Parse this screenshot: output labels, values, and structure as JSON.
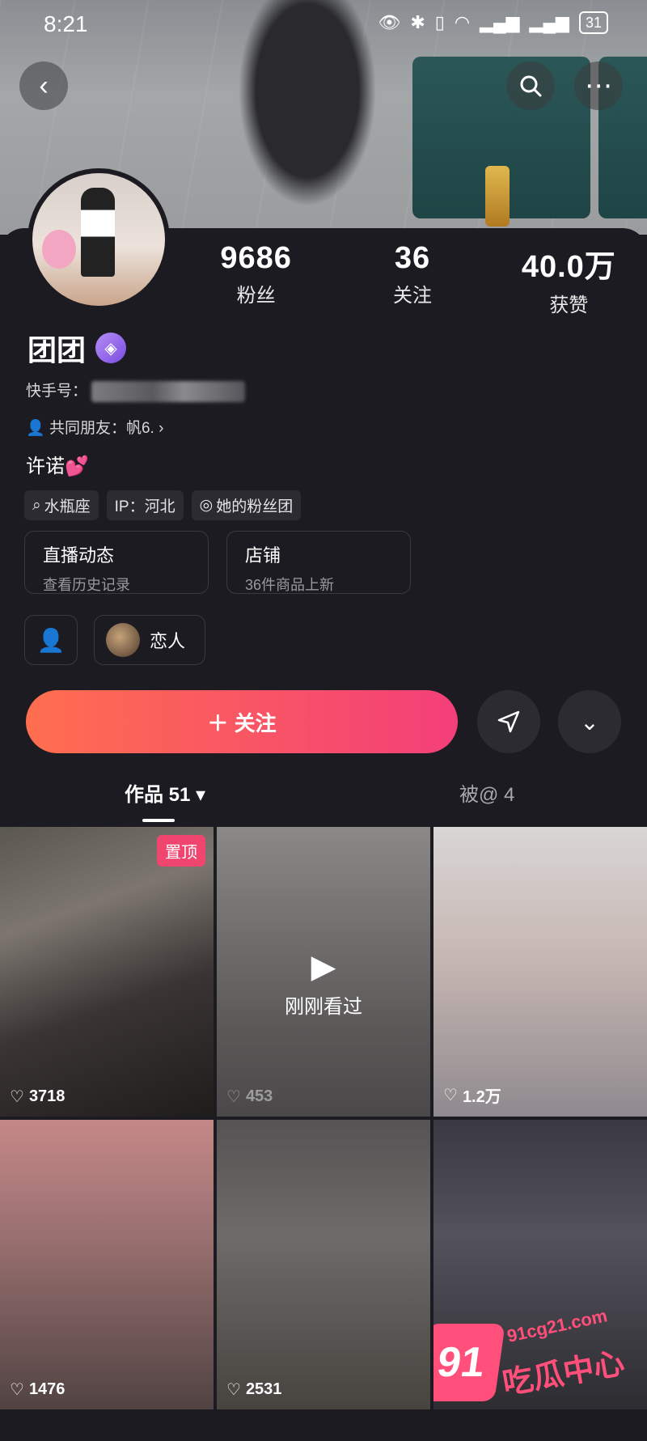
{
  "status_bar": {
    "time": "8:21",
    "icons": [
      "eye-icon",
      "bluetooth-icon",
      "vibrate-icon",
      "wifi-icon",
      "4g-signal-icon",
      "5g-signal-icon"
    ],
    "battery": "31"
  },
  "profile": {
    "stats": [
      {
        "value": "9686",
        "label": "粉丝"
      },
      {
        "value": "36",
        "label": "关注"
      },
      {
        "value": "40.0万",
        "label": "获赞"
      }
    ],
    "name": "团团",
    "kuaishou_id_label": "快手号：",
    "mutual_friends_label": "共同朋友：",
    "mutual_friends_value": "帆6.",
    "bio": "许诺💕",
    "tags": [
      {
        "icon": "search-icon",
        "text": "水瓶座"
      },
      {
        "icon": "",
        "text": "IP：河北"
      },
      {
        "icon": "eye-icon",
        "text": "她的粉丝团"
      }
    ],
    "cards": [
      {
        "title": "直播动态",
        "subtitle": "查看历史记录"
      },
      {
        "title": "店铺",
        "subtitle": "36件商品上新"
      }
    ],
    "lover_label": "恋人"
  },
  "actions": {
    "follow_label": "＋ 关注"
  },
  "tabs": {
    "works_label": "作品 51 ▾",
    "mentioned_label": "被@ 4"
  },
  "videos": [
    {
      "likes": "3718",
      "pinned": true,
      "pin_label": "置顶"
    },
    {
      "likes": "453",
      "play": true,
      "watched_label": "刚刚看过"
    },
    {
      "likes": "1.2万"
    },
    {
      "likes": "1476"
    },
    {
      "likes": "2531"
    },
    {
      "likes": ""
    }
  ],
  "watermark": {
    "badge": "91",
    "site": "91cg21.com",
    "name": "吃瓜中心"
  },
  "colors": {
    "accent_start": "#ff6e4f",
    "accent_end": "#f33f79",
    "background": "#1c1b21"
  }
}
